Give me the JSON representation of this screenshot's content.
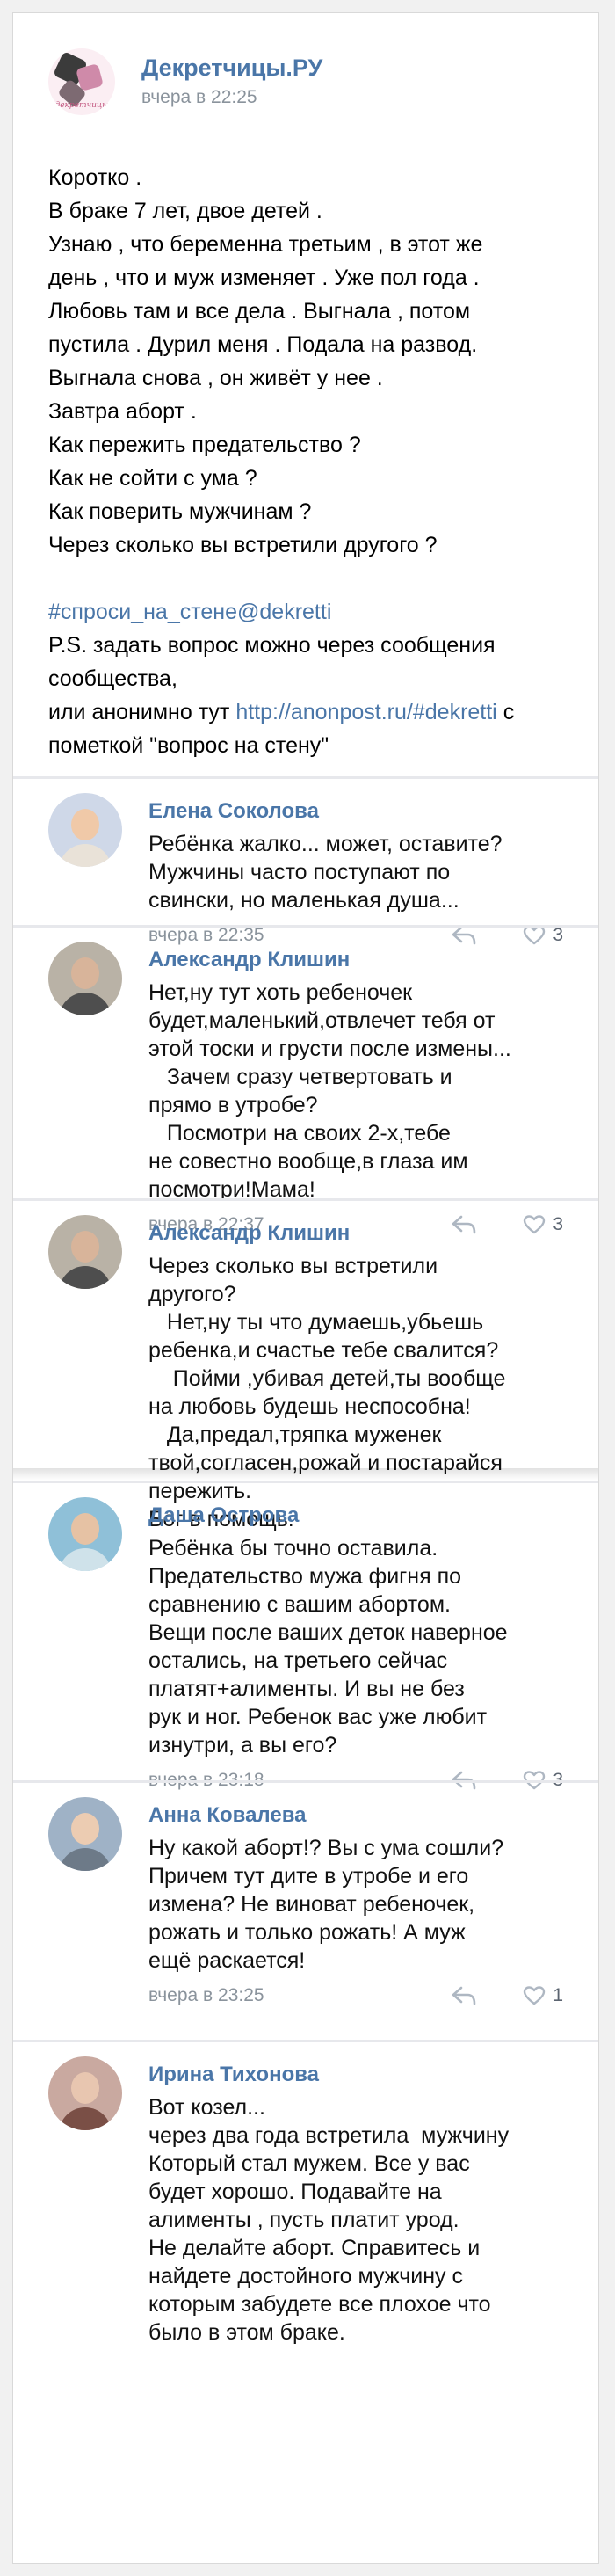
{
  "post": {
    "community_name": "Декретчицы.РУ",
    "logo_text": "декретчицы",
    "time": "вчера в 22:25",
    "lines": [
      "Коротко .",
      "В браке 7 лет, двое детей .",
      "Узнаю , что беременна третьим , в этот же",
      "день , что и муж изменяет . Уже пол года .",
      "Любовь там и все дела . Выгнала , потом",
      "пустила . Дурил меня . Подала на развод.",
      "Выгнала снова , он живёт у нее .",
      "Завтра аборт .",
      "Как пережить предательство ?",
      "Как не сойти с ума ?",
      "Как поверить мужчинам ?",
      "Через сколько вы встретили другого ?"
    ],
    "hashtag": "#спроси_на_стене@dekretti",
    "ps_line1": "P.S. задать вопрос можно через сообщения",
    "ps_line2": "сообщества,",
    "ps_line3_pre": "или анонимно тут ",
    "ps_link": "http://anonpost.ru/#dekretti",
    "ps_line3_post": " с",
    "ps_line4": "пометкой \"вопрос на стену\""
  },
  "comments": [
    {
      "name": "Елена Соколова",
      "lines": [
        "Ребёнка жалко... может, оставите?",
        "Мужчины часто поступают по",
        "свински, но маленькая душа..."
      ],
      "time": "вчера в 22:35",
      "likes": "3",
      "show_footer": true
    },
    {
      "name": "Александр Клишин",
      "lines": [
        "Нет,ну тут хоть ребеночек",
        "будет,маленький,отвлечет тебя от",
        "этой тоски и грусти после измены...",
        "   Зачем сразу четвертовать и",
        "прямо в утробе?",
        "   Посмотри на своих 2-х,тебе",
        "не совестно вообще,в глаза им",
        "посмотри!Мама!"
      ],
      "time": "вчера в 22:37",
      "likes": "3",
      "show_footer": true
    },
    {
      "name": "Александр Клишин",
      "lines": [
        "Через сколько вы встретили",
        "другого?",
        "   Нет,ну ты что думаешь,убьешь",
        "ребенка,и счастье тебе свалится?",
        "    Пойми ,убивая детей,ты вообще",
        "на любовь будешь неспособна!",
        "   Да,предал,тряпка муженек",
        "твой,согласен,рожай и постарайся",
        "пережить.",
        "Бог в помощь."
      ],
      "time": "",
      "likes": "",
      "show_footer": false
    },
    {
      "name": "Даша Острова",
      "lines": [
        "Ребёнка бы точно оставила.",
        "Предательство мужа фигня по",
        "сравнению с вашим абортом.",
        "Вещи после ваших деток наверное",
        "остались, на третьего сейчас",
        "платят+алименты. И вы не без",
        "рук и ног. Ребенок вас уже любит",
        "изнутри, а вы его?"
      ],
      "time": "вчера в 23:18",
      "likes": "3",
      "show_footer": true
    },
    {
      "name": "Анна Ковалева",
      "lines": [
        "Ну какой аборт!? Вы с ума сошли?",
        "Причем тут дите в утробе и его",
        "измена? Не виноват ребеночек,",
        "рожать и только рожать! А муж",
        "ещё раскается!"
      ],
      "time": "вчера в 23:25",
      "likes": "1",
      "show_footer": true
    },
    {
      "name": "Ирина Тихонова",
      "lines": [
        "Вот козел...",
        "через два года встретила  мужчину",
        "Который стал мужем. Все у вас",
        "будет хорошо. Подавайте на",
        "алименты , пусть платит урод.",
        "Не делайте аборт. Справитесь и",
        "найдете достойного мужчину с",
        "которым забудете все плохое что",
        "было в этом браке."
      ],
      "time": "",
      "likes": "",
      "show_footer": false
    }
  ],
  "colors": {
    "link": "#4a76a8",
    "meta": "#8a939c",
    "divider": "#e7e8ec"
  },
  "icons": {
    "reply": "reply-arrow-icon",
    "like": "heart-icon"
  }
}
